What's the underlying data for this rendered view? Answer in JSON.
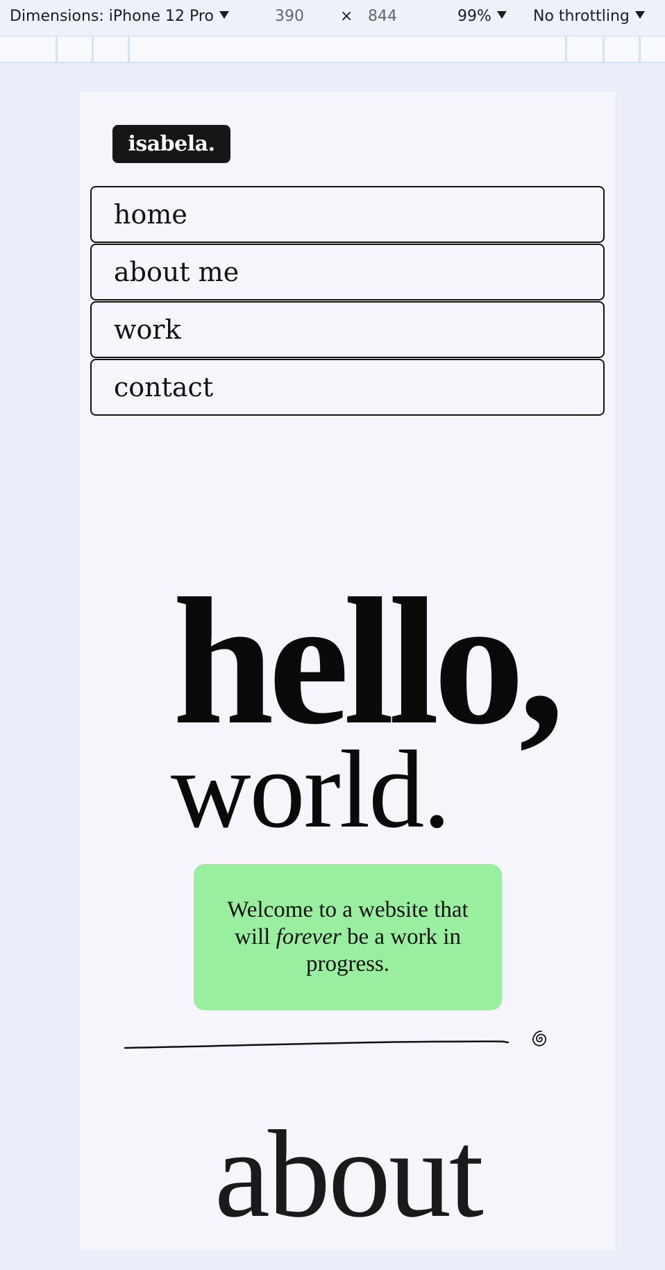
{
  "devtools": {
    "dimensions_label": "Dimensions: iPhone 12 Pro",
    "width": "390",
    "times": "×",
    "height": "844",
    "zoom": "99%",
    "throttling": "No throttling"
  },
  "site": {
    "logo": "isabela.",
    "nav": [
      {
        "label": "home"
      },
      {
        "label": "about me"
      },
      {
        "label": "work"
      },
      {
        "label": "contact"
      }
    ],
    "hero": {
      "line1": "hello,",
      "line2": "world."
    },
    "welcome": {
      "before": "Welcome to a website that will ",
      "emphasis": "forever",
      "after": " be a work in progress."
    },
    "section_heading": "about"
  },
  "colors": {
    "welcome_bg": "#99ee9f",
    "logo_bg": "#161616",
    "page_bg": "#f5f5fb"
  }
}
